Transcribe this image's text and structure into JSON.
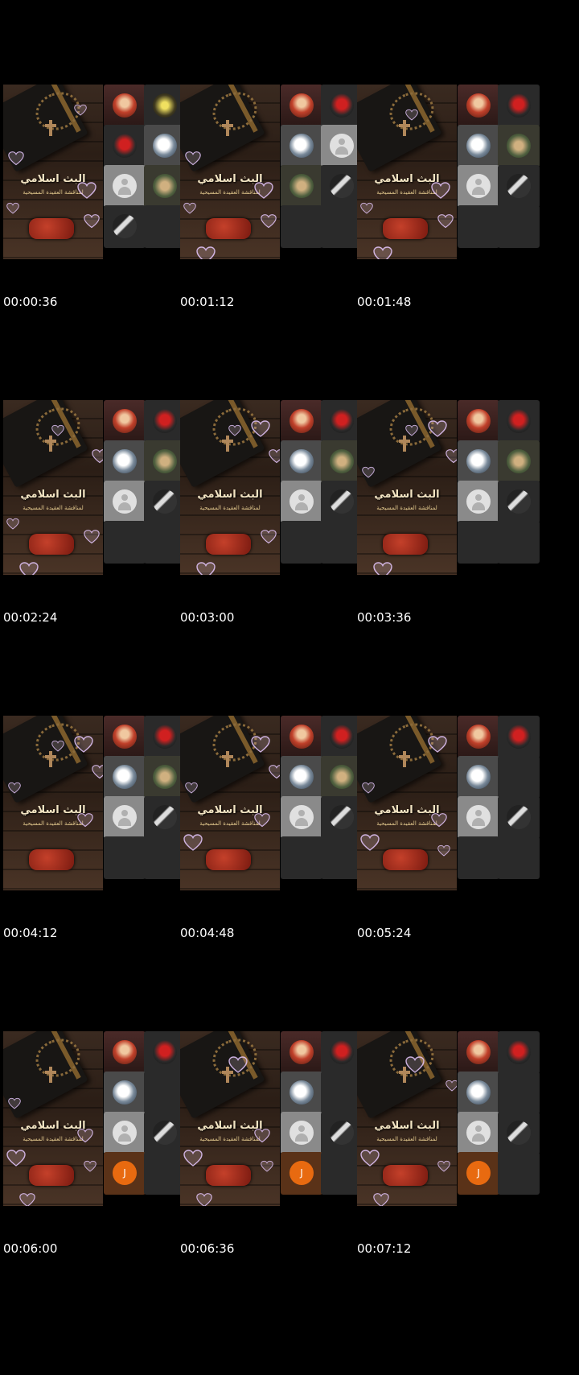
{
  "cover": {
    "title": "البث اسلامي",
    "subtitle": "لمناقشة العقيدة المسيحية"
  },
  "colors": {
    "background": "#000000",
    "timestamp_text": "#ffffff",
    "letter_avatar": "#e86a10"
  },
  "frames": [
    {
      "timestamp": "00:00:36",
      "tiles": [
        "portrait",
        "yellow",
        "redtri",
        "bw",
        "default",
        "outdoor",
        "blade",
        "empty"
      ]
    },
    {
      "timestamp": "00:01:12",
      "tiles": [
        "portrait",
        "redtri",
        "bw",
        "default-light",
        "outdoor",
        "blade",
        "empty",
        "empty"
      ]
    },
    {
      "timestamp": "00:01:48",
      "tiles": [
        "portrait",
        "redtri",
        "bw",
        "outdoor",
        "default-light",
        "blade",
        "empty",
        "empty"
      ]
    },
    {
      "timestamp": "00:02:24",
      "tiles": [
        "portrait",
        "redtri",
        "bw",
        "outdoor",
        "default-light",
        "blade",
        "empty",
        "empty"
      ]
    },
    {
      "timestamp": "00:03:00",
      "tiles": [
        "portrait",
        "redtri",
        "bw",
        "outdoor",
        "default-light",
        "blade",
        "empty",
        "empty"
      ]
    },
    {
      "timestamp": "00:03:36",
      "tiles": [
        "portrait",
        "redtri",
        "bw",
        "outdoor",
        "default-light",
        "blade",
        "empty",
        "empty"
      ]
    },
    {
      "timestamp": "00:04:12",
      "tiles": [
        "portrait",
        "redtri",
        "bw",
        "outdoor",
        "default-light",
        "blade",
        "empty",
        "empty"
      ]
    },
    {
      "timestamp": "00:04:48",
      "tiles": [
        "portrait",
        "redtri",
        "bw",
        "outdoor",
        "default-light",
        "blade",
        "empty",
        "empty"
      ]
    },
    {
      "timestamp": "00:05:24",
      "tiles": [
        "portrait",
        "redtri",
        "bw",
        "empty",
        "default-light",
        "blade",
        "empty",
        "empty"
      ]
    },
    {
      "timestamp": "00:06:00",
      "tiles": [
        "portrait",
        "redtri",
        "bw",
        "empty",
        "default-light",
        "blade",
        "letter",
        "empty"
      ],
      "letter": "J"
    },
    {
      "timestamp": "00:06:36",
      "tiles": [
        "portrait",
        "redtri",
        "bw",
        "empty",
        "default-light",
        "blade",
        "letter",
        "empty"
      ],
      "letter": "J"
    },
    {
      "timestamp": "00:07:12",
      "tiles": [
        "portrait",
        "redtri",
        "bw",
        "empty",
        "default-light",
        "blade",
        "letter",
        "empty"
      ],
      "letter": "J"
    }
  ]
}
